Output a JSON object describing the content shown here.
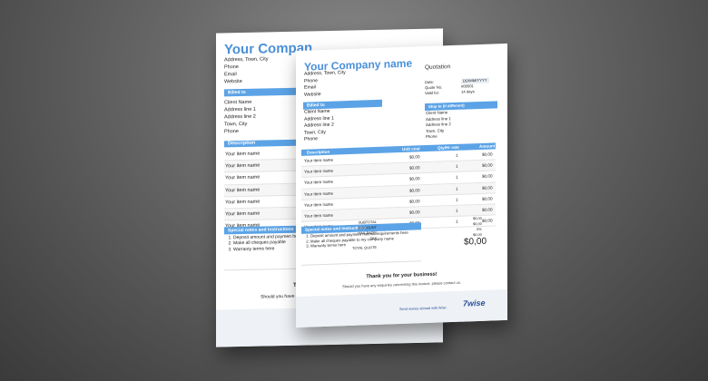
{
  "colors": {
    "accent": "#5ba3e6",
    "company": "#4a90d9",
    "brand": "#2a4f9a"
  },
  "company": {
    "name": "Your Company name",
    "back_name": "Your Compan",
    "address": [
      "Address, Town, City",
      "Phone",
      "Email",
      "Website"
    ]
  },
  "quotation": {
    "title": "Quotation",
    "meta_labels": [
      "Date:",
      "Quote No:",
      "Valid for:"
    ],
    "meta_values": [
      "DD/MM/YYYY",
      "#00001",
      "14 days"
    ]
  },
  "billed_to": {
    "label": "Billed to",
    "lines": [
      "Client Name",
      "Address line 1",
      "Address line 2",
      "Town, City",
      "Phone"
    ]
  },
  "ship_to": {
    "label": "Ship to (if different)",
    "lines": [
      "Client Name",
      "Address line 1",
      "Address line 2",
      "Town, City",
      "Phone"
    ]
  },
  "table": {
    "headers": {
      "description": "Description",
      "unit_cost": "Unit cost",
      "qty": "Qty/Hr rate",
      "amount": "Amount"
    },
    "rows": [
      {
        "name": "Your item name",
        "unit": "$0,00",
        "qty": "1",
        "amount": "$0,00"
      },
      {
        "name": "Your item name",
        "unit": "$0,00",
        "qty": "1",
        "amount": "$0,00"
      },
      {
        "name": "Your item name",
        "unit": "$0,00",
        "qty": "1",
        "amount": "$0,00"
      },
      {
        "name": "Your item name",
        "unit": "$0,00",
        "qty": "1",
        "amount": "$0,00"
      },
      {
        "name": "Your item name",
        "unit": "$0,00",
        "qty": "1",
        "amount": "$0,00"
      },
      {
        "name": "Your item name",
        "unit": "$0,00",
        "qty": "1",
        "amount": "$0,00"
      },
      {
        "name": "Your item name",
        "unit": "$0,00",
        "qty": "1",
        "amount": "$0,00"
      }
    ]
  },
  "notes": {
    "label": "Special notes and instructions",
    "items": [
      "Deposit amount and payment method requirements here",
      "Make all cheques payable to my company name",
      "Warranty terms here"
    ],
    "back_items": [
      "Deposit amount and paymen here",
      "Make all cheques payable",
      "Warranty terms here"
    ]
  },
  "totals": {
    "subtotal_label": "SUBTOTAL",
    "subtotal": "$0,00",
    "discount_label": "DISCOUNT",
    "discount": "$0,00",
    "tax_rate_label": "(TAX RATE)",
    "tax_rate": "0%",
    "tax_label": "TAX",
    "tax": "$0,00",
    "total_label": "TOTAL QUOTE",
    "total": "$0,00"
  },
  "footer": {
    "thanks": "Thank you for your business!",
    "enquiries": "Should you have any enquiries concerning this invoice, please contact us.",
    "back_thanks": "T",
    "back_enquiries": "Should you have c",
    "send_money": "Send money abroad with Wise.",
    "brand": "7wise"
  }
}
